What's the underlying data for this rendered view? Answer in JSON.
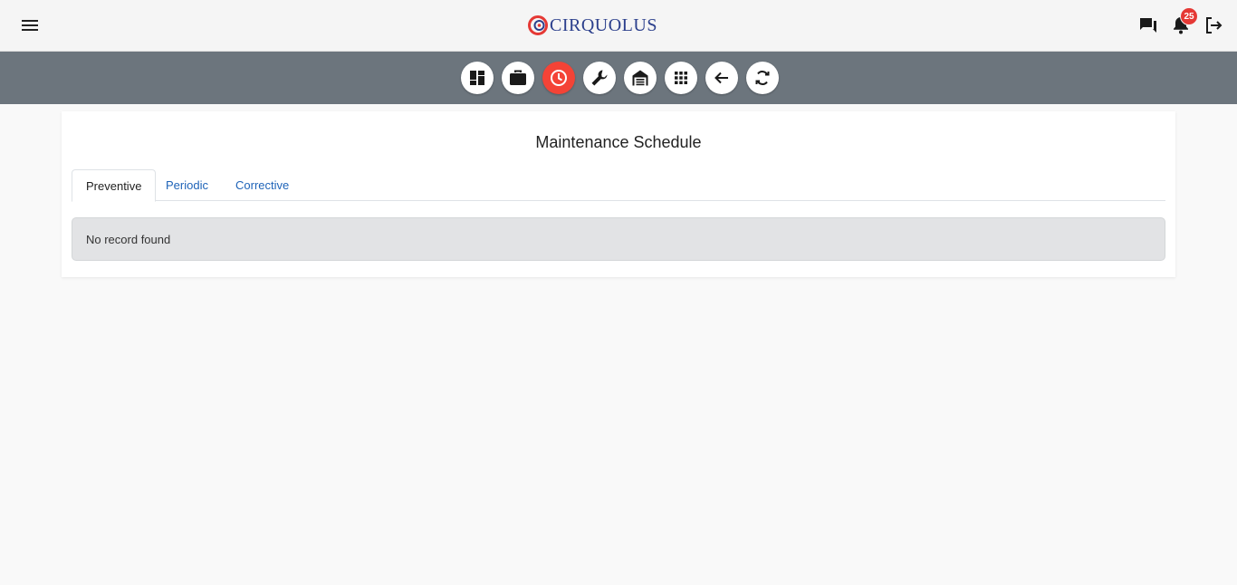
{
  "header": {
    "brand_text": "CIRQUOLUS",
    "brand_color": "#2b3f8c",
    "accent_color": "#e53935",
    "notifications_count": "25",
    "icons": [
      "menu-icon",
      "chat-icon",
      "bell-icon",
      "logout-icon"
    ]
  },
  "toolbar": {
    "background": "#6c757d",
    "active_color": "#f44336",
    "buttons": [
      "dashboard-icon",
      "briefcase-icon",
      "clock-icon",
      "wrench-icon",
      "warehouse-icon",
      "apps-grid-icon",
      "arrow-back-icon",
      "refresh-icon"
    ],
    "active_button": "clock-icon"
  },
  "main": {
    "title": "Maintenance Schedule",
    "tabs": [
      {
        "label": "Preventive",
        "active": true
      },
      {
        "label": "Periodic",
        "active": false
      },
      {
        "label": "Corrective",
        "active": false
      }
    ],
    "empty_message": "No record found"
  }
}
